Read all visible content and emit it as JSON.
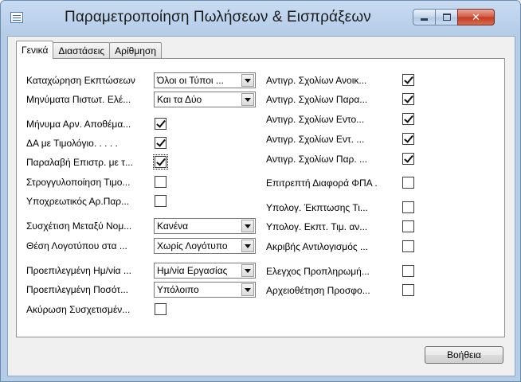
{
  "window": {
    "title": "Παραμετροποίηση Πωλήσεων & Εισπράξεων"
  },
  "tabs": [
    "Γενικά",
    "Διαστάσεις",
    "Αρίθμηση"
  ],
  "left": {
    "disc_posting": {
      "label": "Καταχώρηση Εκπτώσεων",
      "value": "Όλοι οι Τύποι ..."
    },
    "credit_msgs": {
      "label": "Μηνύματα Πιστωτ. Ελέ...",
      "value": "Και τα Δύο"
    },
    "neg_stock_msg": {
      "label": "Μήνυμα Αρν. Αποθέμα...",
      "checked": true
    },
    "da_invoice": {
      "label": "ΔΑ με Τιμολόγιο. . . . .",
      "checked": true
    },
    "return_receipt": {
      "label": "Παραλαβή Επιστρ. με τ...",
      "checked": true
    },
    "rounding": {
      "label": "Στρογγυλοποίηση Τιμο...",
      "checked": false
    },
    "mandatory_ref": {
      "label": "Υποχρεωτικός Αρ.Παρ...",
      "checked": false
    },
    "currency_link": {
      "label": "Συσχέτιση Μεταξύ Νομ...",
      "value": "Κανένα"
    },
    "logo_pos": {
      "label": "Θέση Λογοτύπου στα ...",
      "value": "Χωρίς Λογότυπο"
    },
    "default_date": {
      "label": "Προεπιλεγμένη Ημ/νία ...",
      "value": "Ημ/νία Εργασίας"
    },
    "default_qty": {
      "label": "Προεπιλεγμένη Ποσότ...",
      "value": "Υπόλοιπο"
    },
    "cancel_linked": {
      "label": "Ακύρωση Συσχετισμέν...",
      "checked": false
    }
  },
  "right": {
    "copy_open": {
      "label": "Αντιγρ. Σχολίων Ανοικ...",
      "checked": true
    },
    "copy_para": {
      "label": "Αντιγρ. Σχολίων Παρα...",
      "checked": true
    },
    "copy_ento": {
      "label": "Αντιγρ. Σχολίων Εντο...",
      "checked": true
    },
    "copy_ent": {
      "label": "Αντιγρ. Σχολίων Εντ. ...",
      "checked": true
    },
    "copy_par": {
      "label": "Αντιγρ. Σχολίων Παρ. ...",
      "checked": true
    },
    "vat_diff": {
      "label": "Επιτρεπτή Διαφορά ΦΠΑ .",
      "checked": false
    },
    "calc_disc": {
      "label": "Υπολογ. Έκπτωσης Τι...",
      "checked": false
    },
    "calc_disc_unit": {
      "label": "Υπολογ. Εκπτ. Τιμ. αν...",
      "checked": false
    },
    "exact_reversal": {
      "label": "Ακριβής Αντιλογισμός ...",
      "checked": false
    },
    "prepay_check": {
      "label": "Ελεγχος Προπληρωμή...",
      "checked": false
    },
    "archive_quotes": {
      "label": "Αρχειοθέτηση Προσφο...",
      "checked": false
    }
  },
  "footer": {
    "help": "Βοήθεια"
  }
}
